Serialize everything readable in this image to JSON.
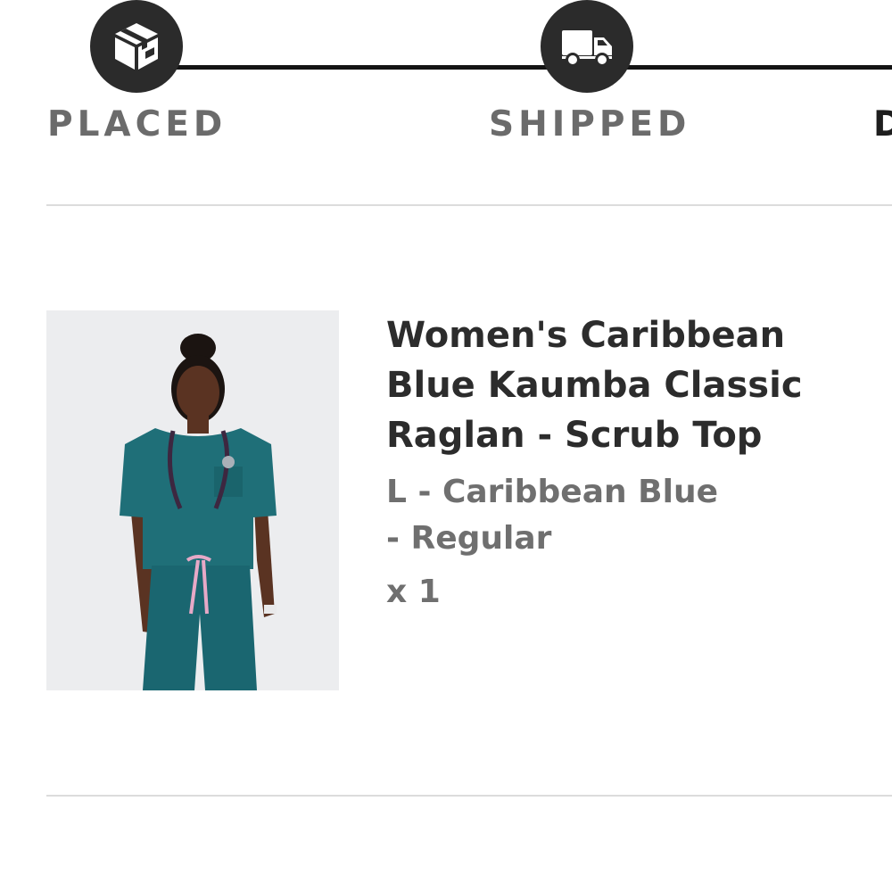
{
  "colors": {
    "step_circle": "#2b2b2b",
    "track_line": "#141414",
    "label_muted": "#6b6b6b",
    "label_active": "#1e1e1e",
    "product_title": "#2c2c2c",
    "product_meta": "#6f6f6f",
    "scrub_teal": "#1f6f78"
  },
  "tracker": {
    "steps": [
      {
        "label": "PLACED",
        "icon": "package-box-icon"
      },
      {
        "label": "SHIPPED",
        "icon": "delivery-truck-icon"
      },
      {
        "label": "D",
        "icon": ""
      }
    ]
  },
  "order_item": {
    "name": "Women's Caribbean\nBlue Kaumba Classic\nRaglan - Scrub Top",
    "variant": "L - Caribbean Blue\n- Regular",
    "quantity": "x 1",
    "image_icon": "product-photo"
  }
}
